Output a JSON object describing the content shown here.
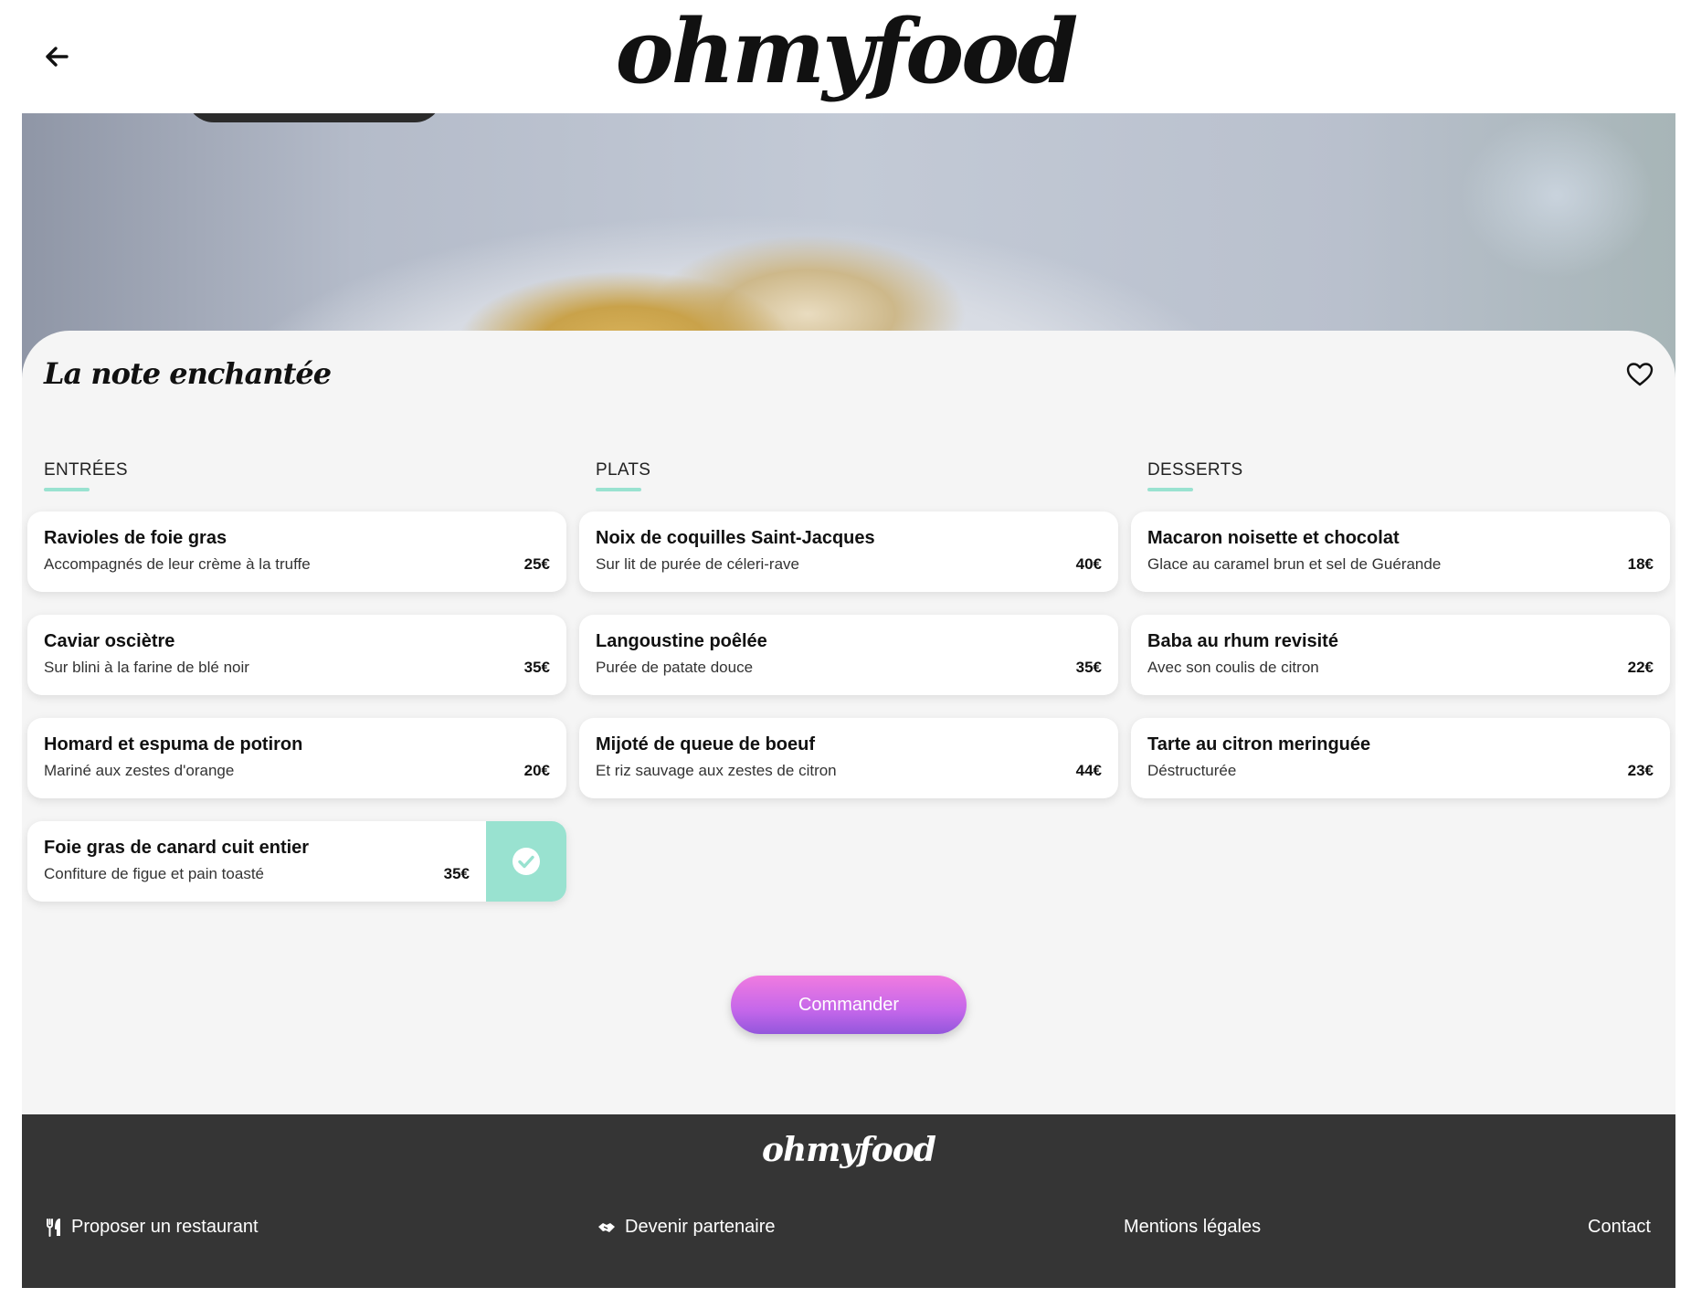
{
  "header": {
    "logo": "ohmyfood",
    "back_icon": "arrow-left-icon"
  },
  "restaurant": {
    "name": "La note enchantée",
    "favorite_icon": "heart-outline-icon"
  },
  "menu": {
    "columns": [
      {
        "title": "ENTRÉES",
        "items": [
          {
            "name": "Ravioles de foie gras",
            "description": "Accompagnés de leur crème à la truffe",
            "price": "25€",
            "selected": false
          },
          {
            "name": "Caviar osciètre",
            "description": "Sur blini à la farine de blé noir",
            "price": "35€",
            "selected": false
          },
          {
            "name": "Homard et espuma de potiron",
            "description": "Mariné aux zestes d'orange",
            "price": "20€",
            "selected": false
          },
          {
            "name": "Foie gras de canard cuit entier",
            "description": "Confiture de figue et pain toasté",
            "price": "35€",
            "selected": true
          }
        ]
      },
      {
        "title": "PLATS",
        "items": [
          {
            "name": "Noix de coquilles Saint-Jacques",
            "description": "Sur lit de purée de céleri-rave",
            "price": "40€",
            "selected": false
          },
          {
            "name": "Langoustine poêlée",
            "description": "Purée de patate douce",
            "price": "35€",
            "selected": false
          },
          {
            "name": "Mijoté de queue de boeuf",
            "description": "Et riz sauvage aux zestes de citron",
            "price": "44€",
            "selected": false
          }
        ]
      },
      {
        "title": "DESSERTS",
        "items": [
          {
            "name": "Macaron noisette et chocolat",
            "description": "Glace au caramel brun et sel de Guérande",
            "price": "18€",
            "selected": false
          },
          {
            "name": "Baba au rhum revisité",
            "description": "Avec son coulis de citron",
            "price": "22€",
            "selected": false
          },
          {
            "name": "Tarte au citron meringuée",
            "description": "Déstructurée",
            "price": "23€",
            "selected": false
          }
        ]
      }
    ]
  },
  "order_button": "Commander",
  "footer": {
    "logo": "ohmyfood",
    "links": [
      {
        "label": "Proposer un restaurant",
        "icon": "utensils-icon"
      },
      {
        "label": "Devenir partenaire",
        "icon": "handshake-icon"
      },
      {
        "label": "Mentions légales",
        "icon": ""
      },
      {
        "label": "Contact",
        "icon": ""
      }
    ]
  },
  "colors": {
    "accent": "#99e2d0",
    "button_gradient_top": "#f07be0",
    "button_gradient_bottom": "#9356dc",
    "footer_bg": "#353535",
    "panel_bg": "#f5f5f5"
  }
}
